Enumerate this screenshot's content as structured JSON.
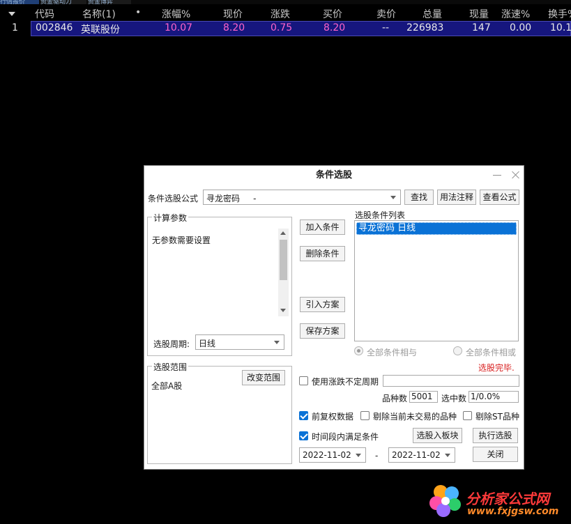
{
  "top_tabs": [
    "行情报价",
    "资金驱动力",
    "资金博弈"
  ],
  "table": {
    "headers": [
      "代码",
      "名称(1)",
      "•",
      "涨幅%",
      "现价",
      "涨跌",
      "买价",
      "卖价",
      "总量",
      "现量",
      "涨速%",
      "换手%"
    ],
    "row": {
      "index": "1",
      "code": "002846",
      "name": "英联股份",
      "change_pct": "10.07",
      "price": "8.20",
      "change": "0.75",
      "bid": "8.20",
      "ask": "--",
      "volume": "226983",
      "cur_volume": "147",
      "speed": "0.00",
      "turnover": "10.1"
    }
  },
  "dialog": {
    "title": "条件选股",
    "formula_label": "条件选股公式",
    "formula_value": "寻龙密码     -",
    "find_button": "查找",
    "usage_button": "用法注释",
    "view_button": "查看公式",
    "params_group": "计算参数",
    "params_text": "无参数需要设置",
    "period_label": "选股周期:",
    "period_value": "日线",
    "add_button": "加入条件",
    "delete_button": "删除条件",
    "import_button": "引入方案",
    "save_button": "保存方案",
    "conditions_label": "选股条件列表",
    "conditions": [
      "寻龙密码  日线"
    ],
    "radio_and": "全部条件相与",
    "radio_or": "全部条件相或",
    "status": "选股完毕.",
    "range_group": "选股范围",
    "range_value": "全部A股",
    "change_range_button": "改变范围",
    "use_period_label": "使用涨跌不定周期",
    "count_label": "品种数",
    "count_value": "5001",
    "selected_label": "选中数",
    "selected_value": "1/0.0%",
    "adjust_label": "前复权数据",
    "exclude_untraded_label": "剔除当前未交易的品种",
    "exclude_st_label": "剔除ST品种",
    "time_range_label": "时间段内满足条件",
    "to_block_button": "选股入板块",
    "execute_button": "执行选股",
    "date_from": "2022-11-02",
    "date_sep": "-",
    "date_to": "2022-11-02",
    "close_button": "关闭"
  },
  "watermark": {
    "title": "分析家公式网",
    "url": "www.fxjgsw.com"
  }
}
